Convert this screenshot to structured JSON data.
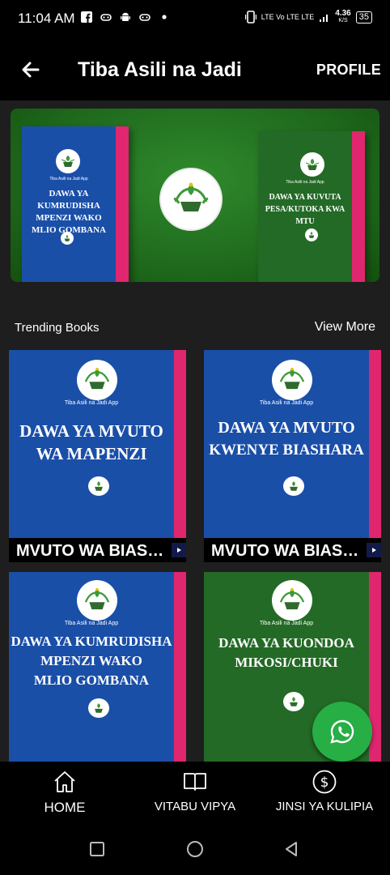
{
  "status_bar": {
    "time": "11:04 AM",
    "network_text": "LTE Vo LTE LTE",
    "speed": "4.36",
    "speed_unit": "K/S",
    "battery": "35"
  },
  "app_bar": {
    "title": "Tiba Asili na Jadi",
    "profile_label": "PROFILE",
    "back_icon": "arrow-left-icon"
  },
  "banner": {
    "left_book": {
      "tag": "Tiba Asili na Jadi App",
      "title": "DAWA YA KUMRUDISHA MPENZI WAKO MLIO GOMBANA"
    },
    "right_book": {
      "tag": "Tiba Asili na Jadi App",
      "title": "DAWA YA KUVUTA PESA/KUTOKA KWA MTU"
    }
  },
  "section": {
    "title": "Trending Books",
    "view_more": "View More"
  },
  "books": [
    {
      "app_label": "Tiba Asili na Jadi App",
      "cover_line1": "DAWA YA MVUTO",
      "cover_line2": "WA MAPENZI",
      "cover_line3": "",
      "caption": "MVUTO WA BIAS…",
      "color": "#1a4fa8"
    },
    {
      "app_label": "Tiba Asili na Jadi App",
      "cover_line1": "DAWA YA MVUTO",
      "cover_line2": "KWENYE BIASHARA",
      "cover_line3": "",
      "caption": "MVUTO WA BIAS…",
      "color": "#1a4fa8"
    },
    {
      "app_label": "Tiba Asili na Jadi App",
      "cover_line1": "DAWA YA KUMRUDISHA",
      "cover_line2": "MPENZI WAKO",
      "cover_line3": "MLIO GOMBANA",
      "caption": "",
      "color": "#1a4fa8"
    },
    {
      "app_label": "Tiba Asili na Jadi App",
      "cover_line1": "DAWA YA KUONDOA",
      "cover_line2": "MIKOSI/CHUKI",
      "cover_line3": "",
      "caption": "",
      "color": "#236a26"
    }
  ],
  "fab": {
    "icon": "whatsapp-icon"
  },
  "bottom_nav": [
    {
      "label": "HOME",
      "icon": "home-icon",
      "active": true
    },
    {
      "label": "VITABU VIPYA",
      "icon": "book-icon",
      "active": false
    },
    {
      "label": "JINSI YA KULIPIA",
      "icon": "dollar-icon",
      "active": false
    }
  ],
  "colors": {
    "background": "#1e1e1e",
    "bar": "#000000",
    "book_blue": "#1a4fa8",
    "book_green": "#236a26",
    "spine_pink": "#e0266f",
    "fab_green": "#27ae45"
  }
}
